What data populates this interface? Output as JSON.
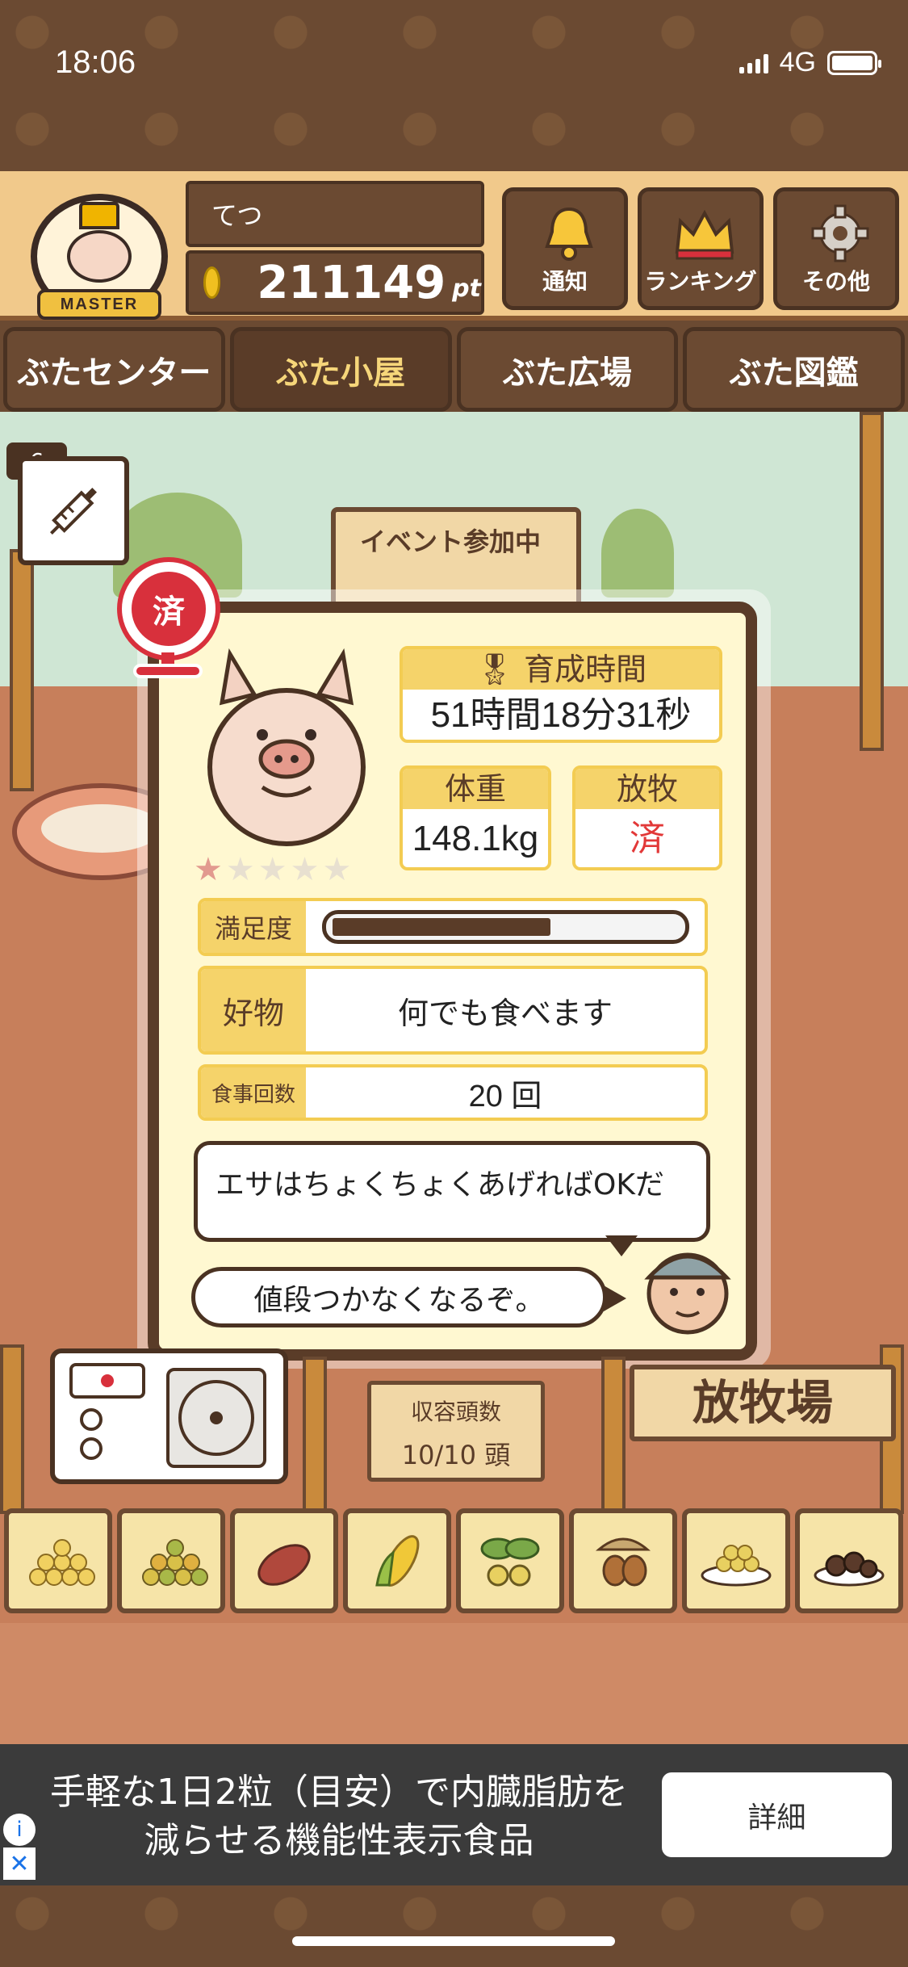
{
  "status_bar": {
    "time": "18:06",
    "network": "4G"
  },
  "header": {
    "badge_label": "MASTER",
    "player_name": "てつ",
    "points": "211149",
    "points_unit": "pt",
    "buttons": [
      {
        "label": "通知",
        "icon": "bell-icon"
      },
      {
        "label": "ランキング",
        "icon": "crown-icon"
      },
      {
        "label": "その他",
        "icon": "gear-icon"
      }
    ]
  },
  "nav": {
    "tabs": [
      {
        "label": "ぶたセンター",
        "active": false
      },
      {
        "label": "ぶた小屋",
        "active": true
      },
      {
        "label": "ぶた広場",
        "active": false
      },
      {
        "label": "ぶた図鑑",
        "active": false
      }
    ]
  },
  "scene": {
    "syringe_count": "6",
    "event_sign": "イベント参加中",
    "capacity_label": "収容頭数",
    "capacity_value": "10/10 頭",
    "pasture_sign": "放牧場"
  },
  "pig_card": {
    "done_stamp": "済",
    "rating": {
      "stars_on": 1,
      "stars_total": 5
    },
    "raising_time_label": "育成時間",
    "raising_time": "51時間18分31秒",
    "weight_label": "体重",
    "weight": "148.1kg",
    "grazing_label": "放牧",
    "grazing": "済",
    "satisfaction_label": "満足度",
    "satisfaction_level": 0.63,
    "favorite_label": "好物",
    "favorite": "何でも食べます",
    "meals_label": "食事回数",
    "meals": "20 回",
    "speech_1": "エサはちょくちょくあげればOKだ",
    "speech_2": "値段つかなくなるぞ。"
  },
  "food_bar": {
    "items": [
      "grain-icon",
      "mixed-grain-icon",
      "sweet-potato-icon",
      "corn-icon",
      "beans-icon",
      "acorn-icon",
      "soybean-bowl-icon",
      "truffle-icon"
    ]
  },
  "ad": {
    "text_line1": "手軽な1日2粒（目安）で内臓脂肪を",
    "text_line2": "減らせる機能性表示食品",
    "button": "詳細"
  },
  "colors": {
    "wood_dark": "#6b4a32",
    "wood_light": "#f1c98b",
    "card_bg": "#fff8d1",
    "label_yellow": "#f5d36a",
    "stamp_red": "#d8303c",
    "grazing_red": "#e23838"
  }
}
